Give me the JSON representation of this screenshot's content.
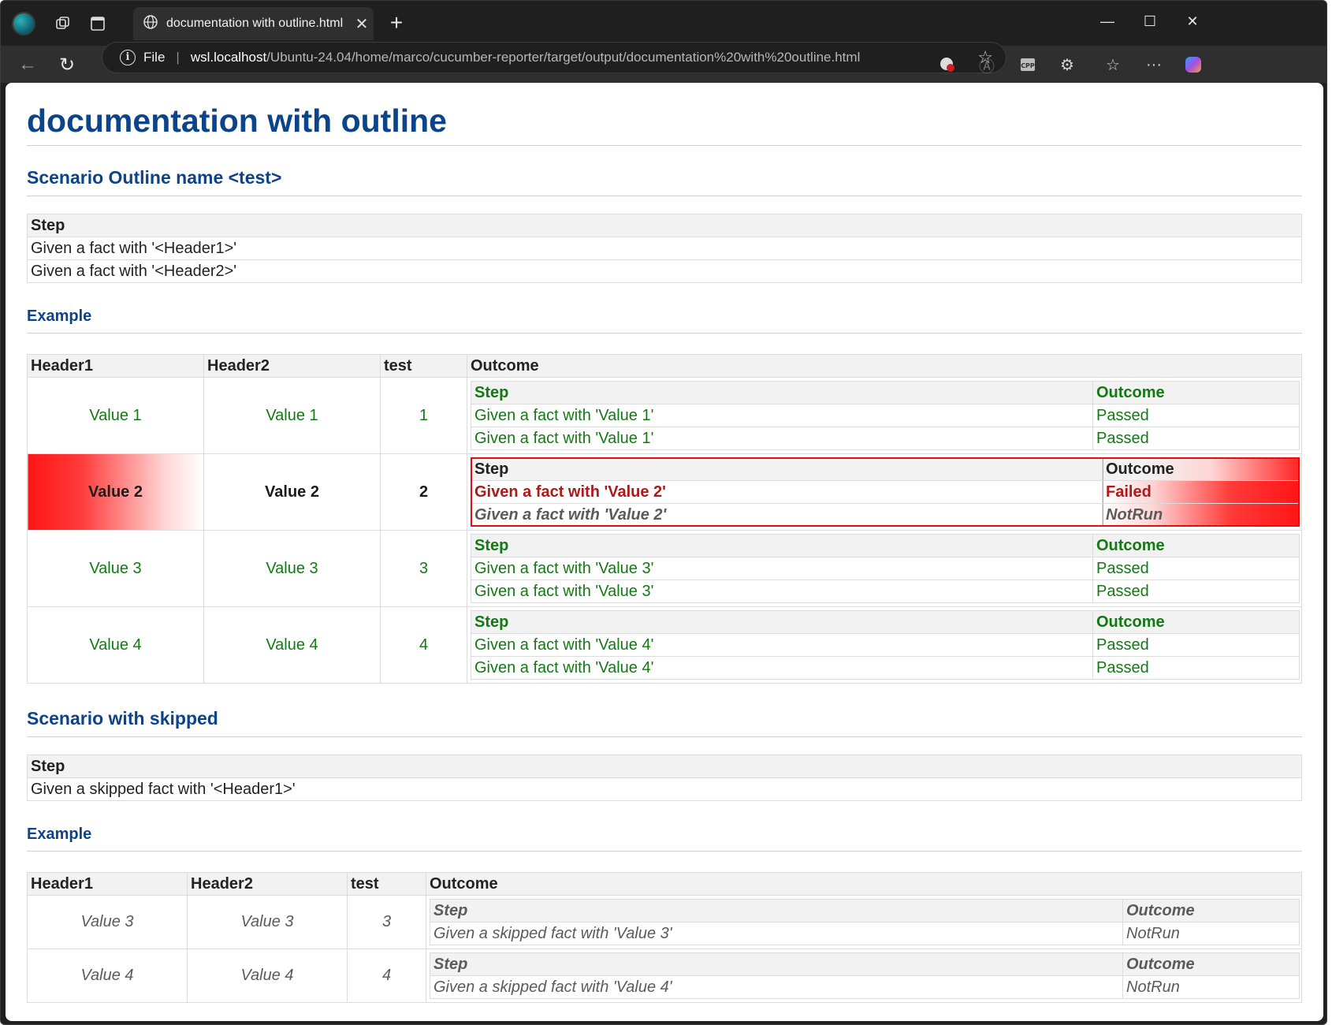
{
  "browser": {
    "tab_title": "documentation with outline.html",
    "address": {
      "scheme": "File",
      "host": "wsl.localhost",
      "path": "/Ubuntu-24.04/home/marco/cucumber-reporter/target/output/documentation%20with%20outline.html"
    }
  },
  "page": {
    "title": "documentation with outline",
    "scenario1": {
      "heading": "Scenario Outline name <test>",
      "step_header": "Step",
      "steps": [
        "Given a fact with '<Header1>'",
        "Given a fact with '<Header2>'"
      ],
      "example_heading": "Example",
      "columns": [
        "Header1",
        "Header2",
        "test",
        "Outcome"
      ],
      "inner_columns": [
        "Step",
        "Outcome"
      ],
      "rows": [
        {
          "status": "passed",
          "header1": "Value 1",
          "header2": "Value 1",
          "test": "1",
          "steps": [
            {
              "text": "Given a fact with 'Value 1'",
              "outcome": "Passed"
            },
            {
              "text": "Given a fact with 'Value 1'",
              "outcome": "Passed"
            }
          ]
        },
        {
          "status": "failed",
          "header1": "Value 2",
          "header2": "Value 2",
          "test": "2",
          "steps": [
            {
              "text": "Given a fact with 'Value 2'",
              "outcome": "Failed"
            },
            {
              "text": "Given a fact with 'Value 2'",
              "outcome": "NotRun"
            }
          ]
        },
        {
          "status": "passed",
          "header1": "Value 3",
          "header2": "Value 3",
          "test": "3",
          "steps": [
            {
              "text": "Given a fact with 'Value 3'",
              "outcome": "Passed"
            },
            {
              "text": "Given a fact with 'Value 3'",
              "outcome": "Passed"
            }
          ]
        },
        {
          "status": "passed",
          "header1": "Value 4",
          "header2": "Value 4",
          "test": "4",
          "steps": [
            {
              "text": "Given a fact with 'Value 4'",
              "outcome": "Passed"
            },
            {
              "text": "Given a fact with 'Value 4'",
              "outcome": "Passed"
            }
          ]
        }
      ]
    },
    "scenario2": {
      "heading": "Scenario with skipped",
      "step_header": "Step",
      "steps": [
        "Given a skipped fact with '<Header1>'"
      ],
      "example_heading": "Example",
      "columns": [
        "Header1",
        "Header2",
        "test",
        "Outcome"
      ],
      "inner_columns": [
        "Step",
        "Outcome"
      ],
      "rows": [
        {
          "header1": "Value 3",
          "header2": "Value 3",
          "test": "3",
          "step": "Given a skipped fact with 'Value 3'",
          "outcome": "NotRun"
        },
        {
          "header1": "Value 4",
          "header2": "Value 4",
          "test": "4",
          "step": "Given a skipped fact with 'Value 4'",
          "outcome": "NotRun"
        }
      ]
    }
  },
  "colors": {
    "heading": "#0b4488",
    "passed": "#137a13",
    "failed": "#b01818",
    "failed_bg": "#ff1515",
    "notrun": "#5b5b5b"
  }
}
